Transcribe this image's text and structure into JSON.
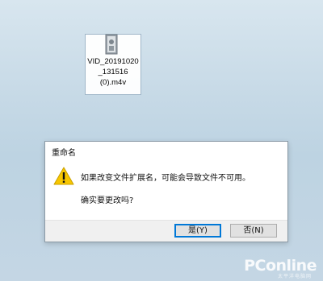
{
  "desktop": {
    "file": {
      "name": "VID_20191020\n_131516\n(0).m4v",
      "icon": "video-file-icon"
    }
  },
  "dialog": {
    "title": "重命名",
    "icon": "warning-icon",
    "message": "如果改变文件扩展名，可能会导致文件不可用。",
    "question": "确实要更改吗?",
    "buttons": {
      "yes": "是(Y)",
      "no": "否(N)"
    }
  },
  "watermark": {
    "brand": "PConline",
    "tagline": "太平洋电脑网"
  },
  "colors": {
    "desktop_bg": "#c6d9e6",
    "accent": "#0078d7",
    "warning": "#f7c600"
  }
}
